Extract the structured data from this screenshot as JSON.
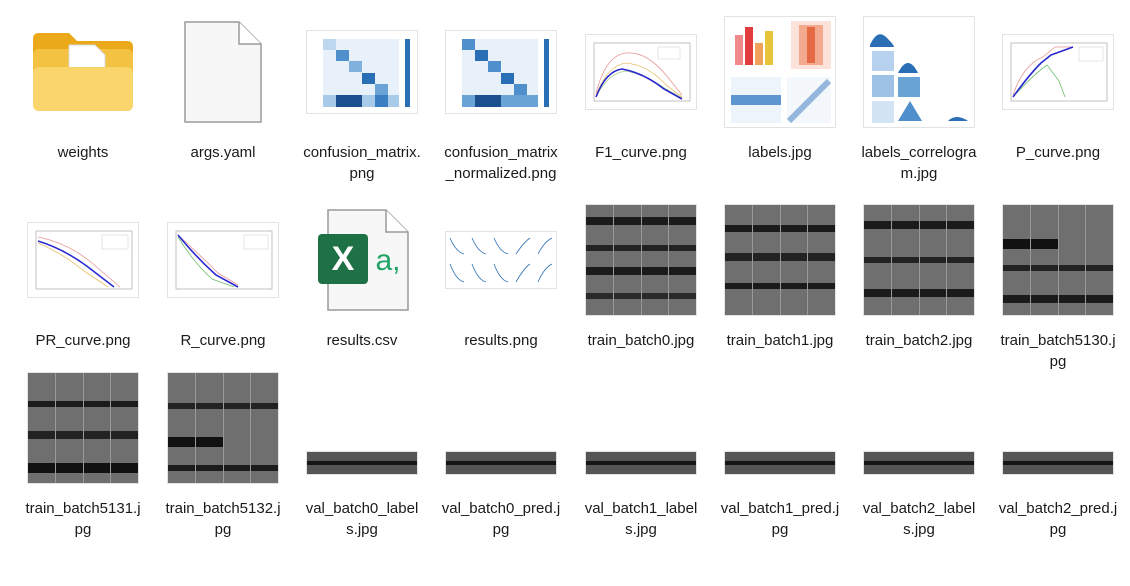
{
  "files": [
    {
      "name": "weights",
      "type": "folder",
      "icon": "folder-icon"
    },
    {
      "name": "args.yaml",
      "type": "file",
      "icon": "blank-file-icon"
    },
    {
      "name": "confusion_matrix.png",
      "type": "image",
      "icon": "confusion-matrix-thumbnail"
    },
    {
      "name": "confusion_matrix_normalized.png",
      "type": "image",
      "icon": "confusion-matrix-normalized-thumbnail"
    },
    {
      "name": "F1_curve.png",
      "type": "image",
      "icon": "f1-curve-thumbnail"
    },
    {
      "name": "labels.jpg",
      "type": "image",
      "icon": "labels-thumbnail"
    },
    {
      "name": "labels_correlogram.jpg",
      "type": "image",
      "icon": "labels-correlogram-thumbnail"
    },
    {
      "name": "P_curve.png",
      "type": "image",
      "icon": "p-curve-thumbnail"
    },
    {
      "name": "PR_curve.png",
      "type": "image",
      "icon": "pr-curve-thumbnail"
    },
    {
      "name": "R_curve.png",
      "type": "image",
      "icon": "r-curve-thumbnail"
    },
    {
      "name": "results.csv",
      "type": "csv",
      "icon": "excel-csv-icon"
    },
    {
      "name": "results.png",
      "type": "image",
      "icon": "results-thumbnail"
    },
    {
      "name": "train_batch0.jpg",
      "type": "image",
      "icon": "train-batch-thumbnail"
    },
    {
      "name": "train_batch1.jpg",
      "type": "image",
      "icon": "train-batch-thumbnail"
    },
    {
      "name": "train_batch2.jpg",
      "type": "image",
      "icon": "train-batch-thumbnail"
    },
    {
      "name": "train_batch5130.jpg",
      "type": "image",
      "icon": "train-batch-thumbnail"
    },
    {
      "name": "train_batch5131.jpg",
      "type": "image",
      "icon": "train-batch-thumbnail"
    },
    {
      "name": "train_batch5132.jpg",
      "type": "image",
      "icon": "train-batch-thumbnail"
    },
    {
      "name": "val_batch0_labels.jpg",
      "type": "image",
      "icon": "val-batch-thumbnail"
    },
    {
      "name": "val_batch0_pred.jpg",
      "type": "image",
      "icon": "val-batch-thumbnail"
    },
    {
      "name": "val_batch1_labels.jpg",
      "type": "image",
      "icon": "val-batch-thumbnail"
    },
    {
      "name": "val_batch1_pred.jpg",
      "type": "image",
      "icon": "val-batch-thumbnail"
    },
    {
      "name": "val_batch2_labels.jpg",
      "type": "image",
      "icon": "val-batch-thumbnail"
    },
    {
      "name": "val_batch2_pred.jpg",
      "type": "image",
      "icon": "val-batch-thumbnail"
    }
  ],
  "csv_badge": {
    "letter": "X",
    "suffix": "a,"
  },
  "colors": {
    "folder": "#f4c242",
    "folder_light": "#f9d56b",
    "excel": "#1e7145",
    "excel_text": "#21a366",
    "chart_blue": "#2a6fb5"
  }
}
